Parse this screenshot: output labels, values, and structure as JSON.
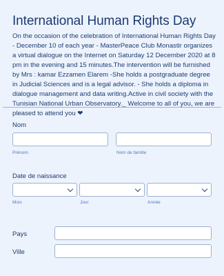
{
  "form": {
    "title": "International Human Rights Day",
    "description": "On the occasion of the celebration of International Human Rights Day - December 10 of each year - MasterPeace Club Monastir organizes a virtual dialogue on the Internet on Saturday 12 December 2020 at 8 pm in the evening and 15 minutes.The intervention will be furnished by Mrs : kamar Ezzamen Elarem -She holds a postgraduate degree in Judicial Sciences and is a legal advisor. - She holds a diploma in dialogue management and data writing.Active in civil society with the Tunisian National Urban Observatory._ Welcome to all of you, we are pleased to attend you ❤"
  },
  "name_field": {
    "label": "Nom",
    "first_sublabel": "Prénom",
    "first_value": "",
    "last_sublabel": "Nom de famille",
    "last_value": ""
  },
  "birthdate_field": {
    "label": "Date de naissance",
    "month_sublabel": "Mois",
    "day_sublabel": "Jour",
    "year_sublabel": "Année",
    "month_value": "",
    "day_value": "",
    "year_value": ""
  },
  "country_field": {
    "label": "Pays",
    "value": ""
  },
  "city_field": {
    "label": "Ville",
    "value": ""
  },
  "colors": {
    "background": "#edf3fd",
    "title": "#1b3a72",
    "sublabel": "#4f7ac0",
    "input_border": "#9db0cf"
  },
  "icons": [
    "chevron-down-icon"
  ]
}
